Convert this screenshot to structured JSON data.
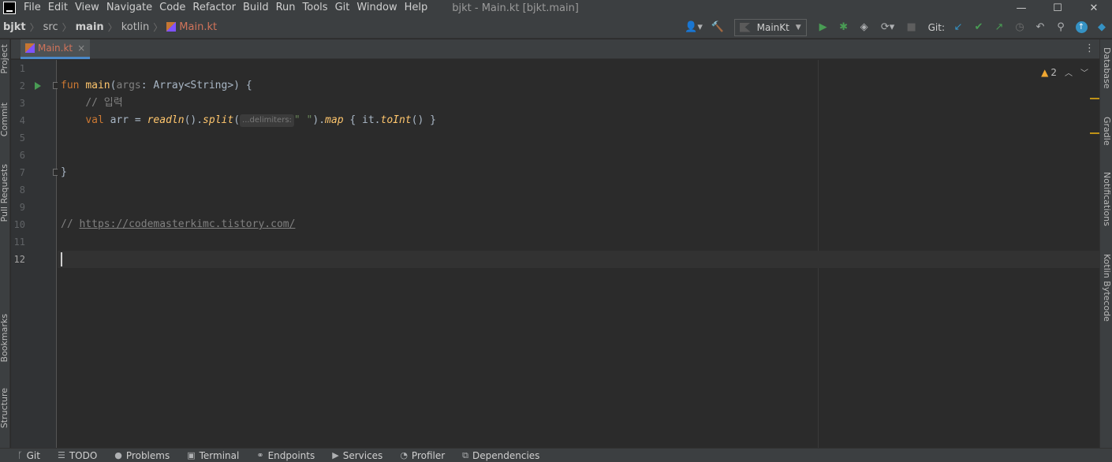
{
  "menubar": {
    "items": [
      "File",
      "Edit",
      "View",
      "Navigate",
      "Code",
      "Refactor",
      "Build",
      "Run",
      "Tools",
      "Git",
      "Window",
      "Help"
    ],
    "window_title": "bjkt - Main.kt [bjkt.main]"
  },
  "navbar": {
    "breadcrumb": [
      "bjkt",
      "src",
      "main",
      "kotlin",
      "Main.kt"
    ],
    "run_config": "MainKt",
    "git_label": "Git:"
  },
  "left_tools": [
    "Project",
    "Commit",
    "Pull Requests",
    "Bookmarks",
    "Structure"
  ],
  "right_tools": [
    "Database",
    "Gradle",
    "Notifications",
    "Kotlin Bytecode"
  ],
  "tab": {
    "label": "Main.kt",
    "close": "×"
  },
  "editor": {
    "line_numbers": [
      "1",
      "2",
      "3",
      "4",
      "5",
      "6",
      "7",
      "8",
      "9",
      "10",
      "11",
      "12"
    ],
    "code": {
      "l2": {
        "kw": "fun",
        "fn": "main",
        "open": "(",
        "param": "args",
        "sig": ": Array<String>) {"
      },
      "l3": {
        "comment": "// 입력"
      },
      "l4": {
        "kw": "val",
        "var": "arr",
        "eq": " = ",
        "f1": "readln",
        "p1": "().",
        "f2": "split",
        "p2": "(",
        "hint": "...delimiters:",
        "str": "\" \"",
        "p3": ").",
        "f3": "map",
        "p4": " { it.",
        "f4": "toInt",
        "p5": "() }"
      },
      "l7": {
        "text": "}"
      },
      "l10": {
        "comment": "// ",
        "link": "https://codemasterkimc.tistory.com/"
      }
    },
    "inspection": {
      "warning_count": "2"
    }
  },
  "bottombar": {
    "items": [
      "Git",
      "TODO",
      "Problems",
      "Terminal",
      "Endpoints",
      "Services",
      "Profiler",
      "Dependencies"
    ]
  },
  "colors": {
    "accent": "#4a88c7",
    "keyword": "#cc7832",
    "function": "#ffc66d",
    "string": "#6a8759",
    "comment": "#808080",
    "run": "#499c54"
  }
}
